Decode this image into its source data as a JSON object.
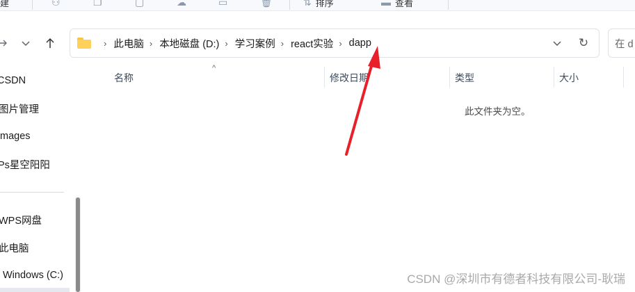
{
  "toolbar": {
    "items": [
      {
        "icon": "share-icon"
      },
      {
        "icon": "copy-icon"
      },
      {
        "icon": "paste-icon"
      },
      {
        "icon": "cloud-icon"
      },
      {
        "icon": "rename-icon"
      },
      {
        "icon": "delete-icon"
      }
    ],
    "partial_label_left": "建",
    "sort_label": "排序",
    "view_label": "查看"
  },
  "address": {
    "breadcrumbs": [
      "此电脑",
      "本地磁盘 (D:)",
      "学习案例",
      "react实验",
      "dapp"
    ],
    "search_placeholder": "在 d"
  },
  "sidebar": {
    "items": [
      "CSDN",
      "图片管理",
      "mages",
      "Ps星空阳阳",
      "WPS网盘",
      "此电脑",
      "Windows (C:)"
    ],
    "selected": "Windows (C:)"
  },
  "columns": [
    "名称",
    "修改日期",
    "类型",
    "大小"
  ],
  "empty_message": "此文件夹为空。",
  "watermark": "CSDN @深圳市有德者科技有限公司-耿瑞",
  "colors": {
    "annotation_arrow": "#e8202a",
    "folder": "#ffd15a"
  }
}
